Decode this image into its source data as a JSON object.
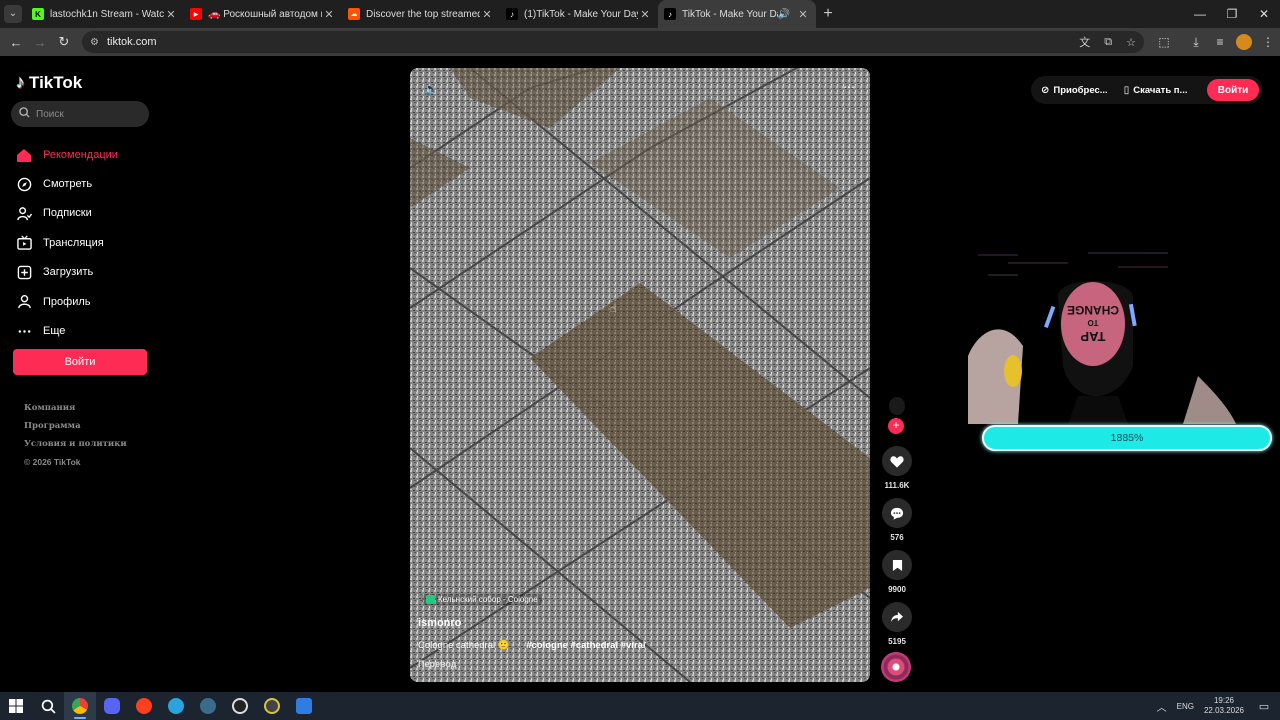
{
  "browser": {
    "tabs": [
      {
        "title": "lastochk1n Stream - Watch Live",
        "favicon_color": "#53fc18",
        "favicon_glyph": "K",
        "active": false
      },
      {
        "title": "🚗 Роскошный автодом кемп...",
        "favicon_color": "#ff0000",
        "favicon_glyph": "▶",
        "active": false
      },
      {
        "title": "Discover the top streamed mus...",
        "favicon_color": "#ff5500",
        "favicon_glyph": "☁",
        "active": false
      },
      {
        "title": "(1)TikTok - Make Your Day",
        "favicon_color": "#000000",
        "favicon_glyph": "♪",
        "active": false
      },
      {
        "title": "TikTok - Make Your Day",
        "favicon_color": "#000000",
        "favicon_glyph": "♪",
        "active": true
      }
    ],
    "url": "tiktok.com"
  },
  "sidebar": {
    "logo_text": "TikTok",
    "search_placeholder": "Поиск",
    "items": [
      {
        "label": "Рекомендации",
        "icon": "home-icon",
        "active": true
      },
      {
        "label": "Смотреть",
        "icon": "compass-icon",
        "active": false
      },
      {
        "label": "Подписки",
        "icon": "user-follow-icon",
        "active": false
      },
      {
        "label": "Трансляция",
        "icon": "live-tv-icon",
        "active": false
      },
      {
        "label": "Загрузить",
        "icon": "upload-icon",
        "active": false
      },
      {
        "label": "Профиль",
        "icon": "profile-icon",
        "active": false
      },
      {
        "label": "Еще",
        "icon": "more-icon",
        "active": false
      }
    ],
    "login_label": "Войти",
    "footer": {
      "company": "Компания",
      "program": "Программа",
      "terms": "Условия и политики",
      "copyright": "© 2026 TikTok"
    }
  },
  "video": {
    "location": "Кельнский собор - Cologne",
    "author": "ismonro",
    "caption": "Cologne cathedral 🙂",
    "hashtags": "#cologne #cathedral #viral",
    "translate": "Перевод"
  },
  "actions": {
    "likes": "111.6K",
    "comments": "576",
    "saves": "9900",
    "shares": "5195"
  },
  "topbar": {
    "acquire": "Приобрес...",
    "download": "Скачать п...",
    "login": "Войти"
  },
  "overlay": {
    "progress_text": "1885%"
  },
  "taskbar": {
    "lang": "ENG",
    "time": "19:26",
    "date": "22.03.2026"
  },
  "colors": {
    "accent": "#fe2c55",
    "progress": "#1de9e6"
  }
}
